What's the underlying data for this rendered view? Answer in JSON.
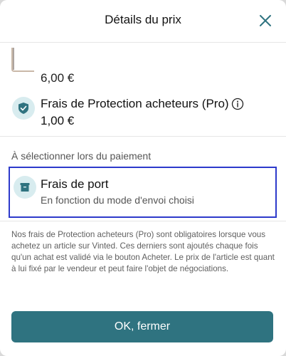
{
  "header": {
    "title": "Détails du prix"
  },
  "item": {
    "price": "6,00 €"
  },
  "buyer_protection": {
    "title": "Frais de Protection acheteurs (Pro)",
    "price": "1,00 €"
  },
  "checkout_section": {
    "label": "À sélectionner lors du paiement"
  },
  "shipping": {
    "title": "Frais de port",
    "subtitle": "En fonction du mode d'envoi choisi"
  },
  "notice": {
    "text": "Nos frais de Protection acheteurs (Pro) sont obligatoires lorsque vous achetez un article sur Vinted. Ces derniers sont ajoutés chaque fois qu'un achat est validé via le bouton Acheter. Le prix de l'article est quant à lui fixé par le vendeur et peut faire l'objet de négociations."
  },
  "footer": {
    "ok_label": "OK, fermer"
  },
  "colors": {
    "accent": "#2f7380",
    "highlight_border": "#2d3acb",
    "icon_bg": "#d8ecef"
  },
  "icons": {
    "close": "close-icon",
    "shield": "shield-icon",
    "info": "info-icon",
    "package": "package-icon"
  }
}
